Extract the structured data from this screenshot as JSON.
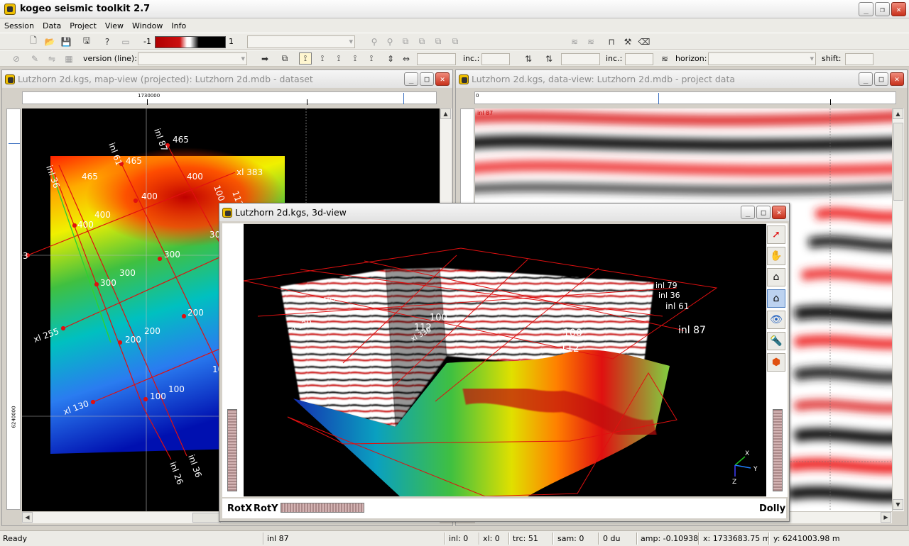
{
  "app": {
    "title": "kogeo seismic toolkit 2.7"
  },
  "menu": [
    "Session",
    "Data",
    "Project",
    "View",
    "Window",
    "Info"
  ],
  "toolbar": {
    "color_min": "-1",
    "color_max": "1",
    "version_label": "version (line):",
    "inc_label_1": "inc.:",
    "inc_label_2": "inc.:",
    "horizon_label": "horizon:",
    "shift_label": "shift:"
  },
  "windows": {
    "map": {
      "title": "Lutzhorn 2d.kgs, map-view (projected): Lutzhorn 2d.mdb - dataset",
      "ruler_x": "1730000",
      "ruler_y": "6240000",
      "labels": [
        "inl 87",
        "465",
        "inl 61",
        "465",
        "inl 36",
        "465",
        "400",
        "400",
        "400",
        "400",
        "xl 383",
        "112",
        "100",
        "300",
        "300",
        "300",
        "200",
        "200",
        "200",
        "100",
        "100",
        "xl 255",
        "xl 130",
        "inl 26",
        "inl 36",
        "3",
        "30",
        "10"
      ]
    },
    "data": {
      "title": "Lutzhorn 2d.kgs, data-view: Lutzhorn 2d.mdb - project data",
      "ruler_x": "0",
      "line_tag": "inl 87"
    },
    "view3d": {
      "title": "Lutzhorn 2d.kgs, 3d-view",
      "labels": [
        "inl 79",
        "inl 36",
        "inl 61",
        "inl 87",
        "xl 130",
        "100",
        "112",
        "100",
        "112",
        "100",
        "xl 330"
      ],
      "rotx": "RotX",
      "roty": "RotY",
      "dolly": "Dolly",
      "axis_x": "X",
      "axis_y": "Y",
      "axis_z": "Z"
    }
  },
  "status": {
    "ready": "Ready",
    "line": "inl 87",
    "inl": "inl: 0",
    "xl": "xl: 0",
    "trc": "trc: 51",
    "sam": "sam: 0",
    "du": "0 du",
    "amp": "amp: -0.10938",
    "x": "x: 1733683.75 m",
    "y": "y: 6241003.98 m"
  }
}
